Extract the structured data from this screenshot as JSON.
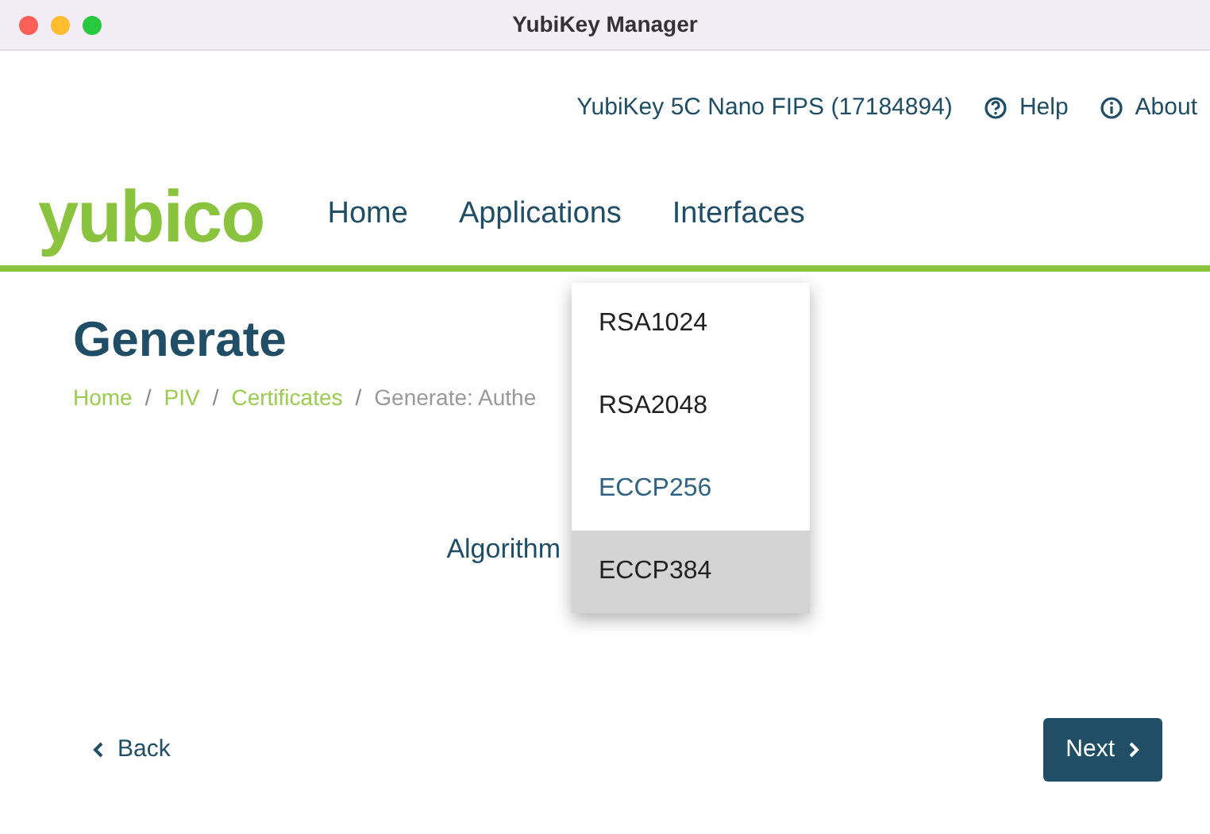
{
  "window": {
    "title": "YubiKey Manager"
  },
  "header": {
    "device": "YubiKey 5C Nano FIPS (17184894)",
    "links": [
      {
        "label": "Help",
        "kind": "help"
      },
      {
        "label": "About",
        "kind": "about"
      }
    ]
  },
  "logo": "yubico",
  "nav": [
    {
      "label": "Home"
    },
    {
      "label": "Applications"
    },
    {
      "label": "Interfaces"
    }
  ],
  "page": {
    "title": "Generate",
    "separator": "/",
    "breadcrumb": [
      {
        "label": "Home",
        "link": true
      },
      {
        "label": "PIV",
        "link": true
      },
      {
        "label": "Certificates",
        "link": true
      },
      {
        "label": "Generate: Authe",
        "link": false
      }
    ]
  },
  "algorithm": {
    "label": "Algorithm",
    "options": [
      {
        "label": "RSA1024",
        "selected": false,
        "highlighted": false
      },
      {
        "label": "RSA2048",
        "selected": false,
        "highlighted": false
      },
      {
        "label": "ECCP256",
        "selected": true,
        "highlighted": false
      },
      {
        "label": "ECCP384",
        "selected": false,
        "highlighted": true
      }
    ]
  },
  "buttons": {
    "back": "Back",
    "next": "Next"
  }
}
